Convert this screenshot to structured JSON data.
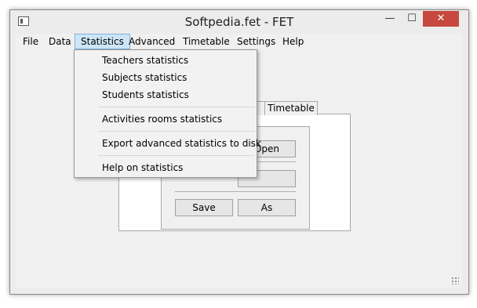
{
  "window": {
    "title": "Softpedia.fet - FET",
    "minimize_glyph": "—",
    "maximize_glyph": "☐",
    "close_glyph": "✕"
  },
  "menubar": {
    "items": [
      "File",
      "Data",
      "Statistics",
      "Advanced",
      "Timetable",
      "Settings",
      "Help"
    ],
    "active": "Statistics"
  },
  "statistics_menu": {
    "items": [
      "Teachers statistics",
      "Subjects statistics",
      "Students statistics",
      "Activities rooms statistics",
      "Export advanced statistics to disk",
      "Help on statistics"
    ]
  },
  "main": {
    "tab_timetable": "Timetable",
    "open_button": "Open",
    "save_button": "Save",
    "save_as_button": "As"
  },
  "colors": {
    "close_button": "#c7483f",
    "menu_highlight": "#cde6f7"
  }
}
